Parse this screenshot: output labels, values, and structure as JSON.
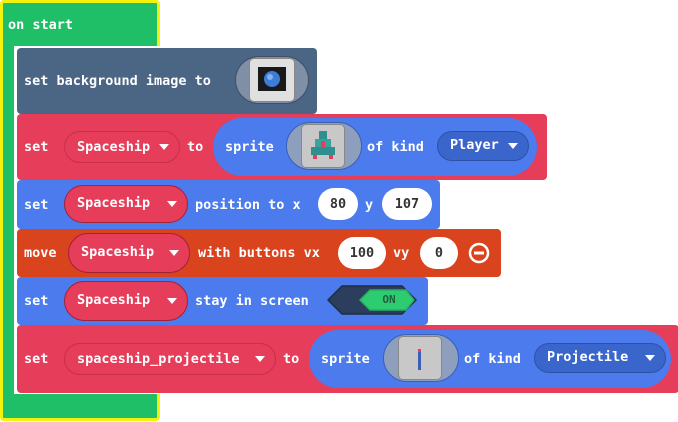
{
  "on_start": {
    "label": "on start"
  },
  "set_background": {
    "label": "set background image to",
    "image": "earth-image-icon"
  },
  "set_sprite": {
    "set_label": "set",
    "variable": "Spaceship",
    "to_label": "to",
    "sprite_label": "sprite",
    "image": "spaceship-sprite-icon",
    "kind_label": "of kind",
    "kind": "Player"
  },
  "set_position": {
    "set_label": "set",
    "variable": "Spaceship",
    "position_label": "position to x",
    "x": "80",
    "y_label": "y",
    "y": "107"
  },
  "move_buttons": {
    "move_label": "move",
    "variable": "Spaceship",
    "with_label": "with buttons vx",
    "vx": "100",
    "vy_label": "vy",
    "vy": "0",
    "remove_icon": "minus-circle-icon"
  },
  "stay_in_screen": {
    "set_label": "set",
    "variable": "Spaceship",
    "stay_label": "stay in screen",
    "toggle": "ON"
  },
  "set_projectile": {
    "set_label": "set",
    "variable": "spaceship_projectile",
    "to_label": "to",
    "sprite_label": "sprite",
    "image": "projectile-sprite-icon",
    "kind_label": "of kind",
    "kind": "Projectile"
  },
  "colors": {
    "event": "#1fbf68",
    "highlight": "#f2f20f",
    "scene": "#4b6584",
    "sprites": "#e53d5a",
    "sprite_prop": "#4b7bec",
    "controller": "#d9431e",
    "toggle_on": "#2ecc71"
  }
}
